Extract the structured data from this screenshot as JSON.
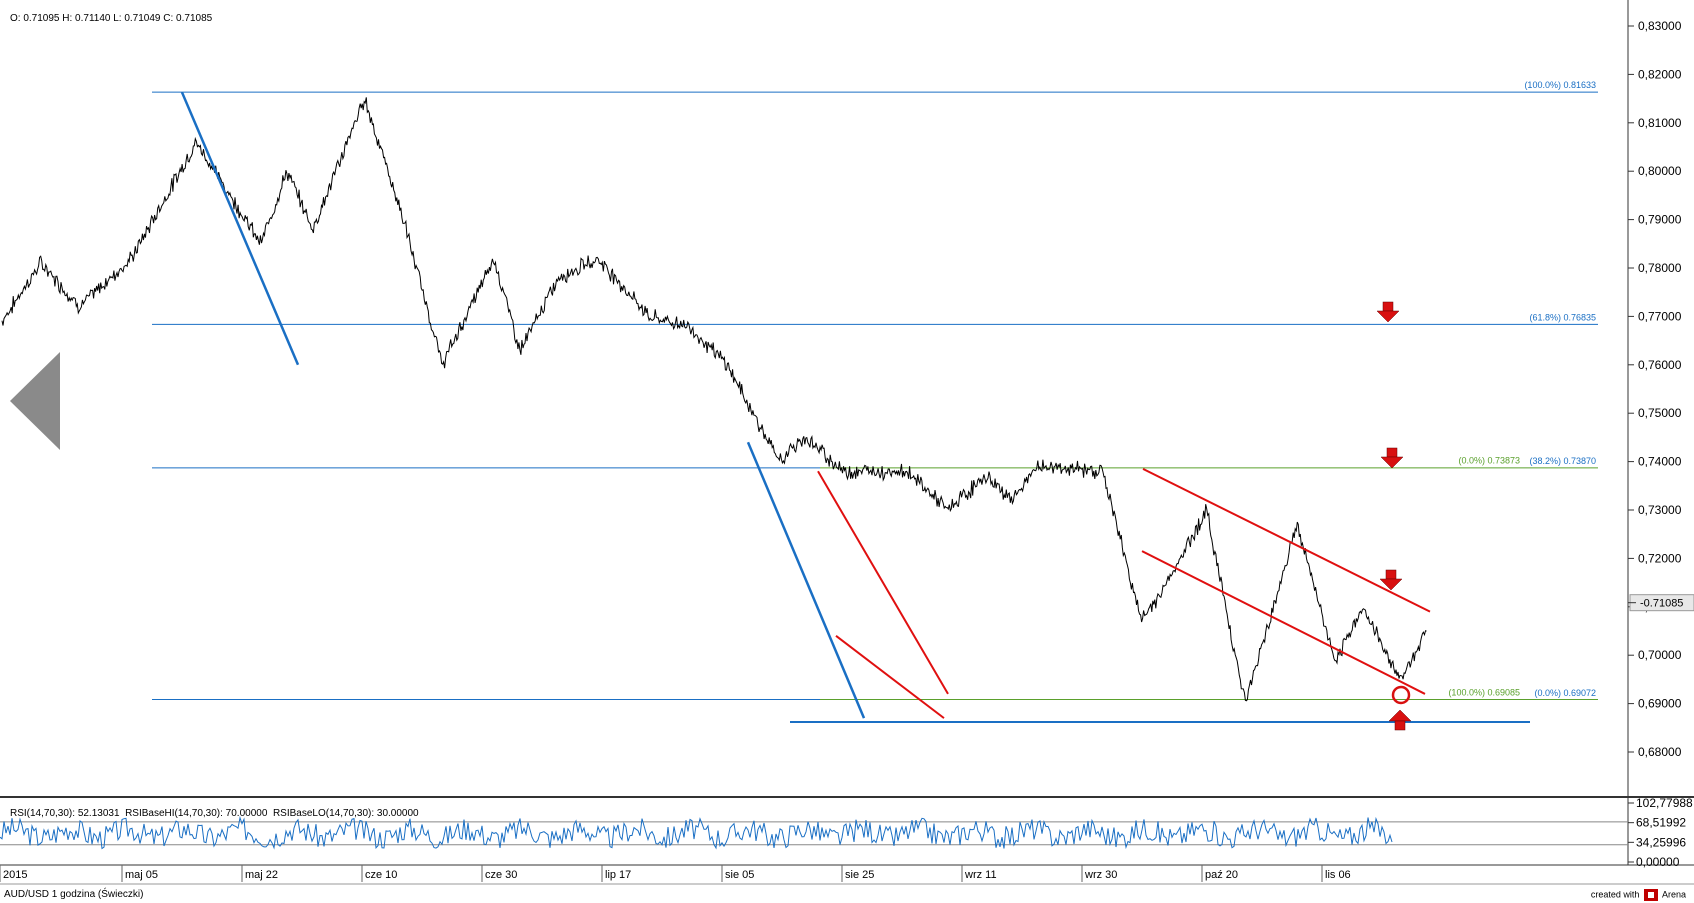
{
  "header": {
    "ohlc": "O: 0.71095 H: 0.71140 L: 0.71049 C: 0.71085"
  },
  "chart_data": [
    {
      "type": "line",
      "title": "",
      "instrument": "AUD/USD 1 godzina (Świeczki)",
      "xlabel": "",
      "ylabel": "",
      "ylim": [
        0.6735,
        0.8355
      ],
      "y_ticks": [
        "0,83000",
        "0,82000",
        "0,81000",
        "0,80000",
        "0,79000",
        "0,78000",
        "0,77000",
        "0,76000",
        "0,75000",
        "0,74000",
        "0,73000",
        "0,72000",
        "0,71000",
        "0,70000",
        "0,69000",
        "0,68000"
      ],
      "x_ticks": [
        "2015",
        "maj 05",
        "maj 22",
        "cze 10",
        "cze 30",
        "lip 17",
        "sie 05",
        "sie 25",
        "wrz 11",
        "wrz 30",
        "paź 20",
        "lis 06"
      ],
      "series": [
        {
          "x": [
            0,
            0.3,
            0.6,
            1.0,
            1.5,
            2.0,
            2.2,
            2.4,
            2.8,
            3.1,
            3.4,
            3.8,
            4.0,
            4.3,
            4.6,
            5.0,
            5.3,
            5.6,
            6.0,
            6.2,
            6.5,
            7.0,
            7.3,
            7.6,
            7.8,
            8.0,
            8.5,
            8.8,
            9.0,
            9.3,
            9.6,
            10.0,
            10.3,
            10.5,
            10.8,
            11.0
          ],
          "values": [
            0.769,
            0.781,
            0.772,
            0.782,
            0.806,
            0.785,
            0.8,
            0.788,
            0.815,
            0.79,
            0.76,
            0.782,
            0.763,
            0.778,
            0.782,
            0.77,
            0.768,
            0.76,
            0.74,
            0.745,
            0.738,
            0.738,
            0.73,
            0.737,
            0.732,
            0.739,
            0.738,
            0.707,
            0.715,
            0.73,
            0.69,
            0.727,
            0.698,
            0.71,
            0.695,
            0.705
          ]
        }
      ],
      "last_price": "0.71085",
      "fibonacci_levels": [
        {
          "label": "(100.0%) 0.81633",
          "value": 0.81633
        },
        {
          "label": "(61.8%) 0.76835",
          "value": 0.76835
        },
        {
          "label": "(38.2%) 0.73870",
          "value": 0.7387
        },
        {
          "label": "(0.0%) 0.73873",
          "value": 0.73873
        },
        {
          "label": "(100.0%) 0.69085",
          "value": 0.69085
        },
        {
          "label": "(0.0%) 0.69072",
          "value": 0.69072
        }
      ],
      "grid": false,
      "colors": {
        "price": "#000000",
        "fib": "#1a6fc4",
        "fib_green": "#5aa02c",
        "channel": "#e01010",
        "trendline": "#1a6fc4",
        "marker": "#d81010"
      }
    },
    {
      "type": "line",
      "title": "",
      "legend": "RSI(14,70,30): 52.13031  RSIBaseHI(14,70,30): 70.00000  RSIBaseLO(14,70,30): 30.00000",
      "y_ticks": [
        "102,77988",
        "68,51992",
        "34,25996",
        "0,00000"
      ],
      "ylim": [
        0,
        102.77988
      ],
      "levels": [
        70,
        30
      ],
      "last_value": 52.13031,
      "colors": {
        "rsi": "#1a6fc4",
        "levels": "#888888"
      }
    }
  ],
  "footer": {
    "instrument_label": "AUD/USD 1 godzina (Świeczki)",
    "credit": "created with",
    "brand": "Arena"
  },
  "icons": {
    "nav_left": "triangle-left-icon",
    "arrow_down": "arrow-down-icon",
    "arrow_up": "arrow-up-icon",
    "target_circle": "circle-icon"
  }
}
